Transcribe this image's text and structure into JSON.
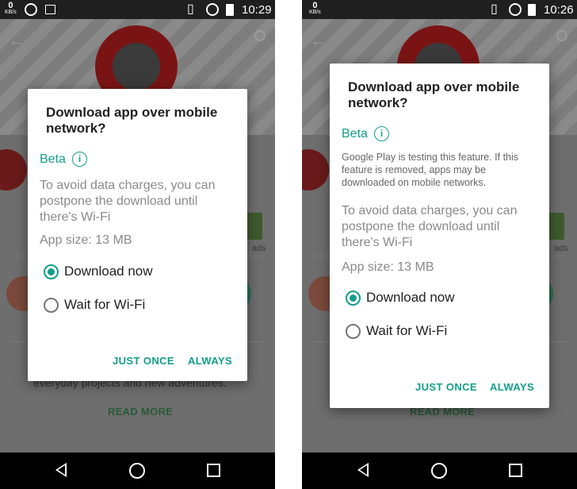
{
  "screens": [
    {
      "status_bar": {
        "data_rate": "0",
        "data_unit": "KB/s",
        "time": "10:29"
      },
      "background": {
        "read_more": "READ MORE",
        "description_snippet": "everyday projects and new adventures.",
        "side_label": "ads"
      },
      "dialog": {
        "title": "Download app over mobile network?",
        "beta_label": "Beta",
        "info_glyph": "i",
        "body": "To avoid data charges, you can postpone the download until there's Wi-Fi",
        "app_size": "App size: 13 MB",
        "options": [
          {
            "label": "Download now",
            "selected": true
          },
          {
            "label": "Wait for Wi-Fi",
            "selected": false
          }
        ],
        "buttons": {
          "just_once": "JUST ONCE",
          "always": "ALWAYS"
        }
      }
    },
    {
      "status_bar": {
        "data_rate": "0",
        "data_unit": "KB/s",
        "time": "10:26"
      },
      "background": {
        "read_more": "READ MORE",
        "side_label": "ads"
      },
      "dialog": {
        "title": "Download app over mobile network?",
        "beta_label": "Beta",
        "info_glyph": "i",
        "beta_note": "Google Play is testing this feature. If this feature is removed, apps may be downloaded on mobile networks.",
        "body": "To avoid data charges, you can postpone the download until there's Wi-Fi",
        "app_size": "App size: 13 MB",
        "options": [
          {
            "label": "Download now",
            "selected": true
          },
          {
            "label": "Wait for Wi-Fi",
            "selected": false
          }
        ],
        "buttons": {
          "just_once": "JUST ONCE",
          "always": "ALWAYS"
        }
      }
    }
  ],
  "colors": {
    "accent": "#129e8a",
    "status_bar": "#1f1f1f",
    "nav_bar": "#000000",
    "dim_background": "#6f6f6f"
  },
  "icons": [
    "whatsapp-icon",
    "image-notification-icon",
    "vibrate-icon",
    "alarm-icon",
    "battery-icon",
    "back-icon",
    "home-icon",
    "recents-icon",
    "info-icon"
  ]
}
